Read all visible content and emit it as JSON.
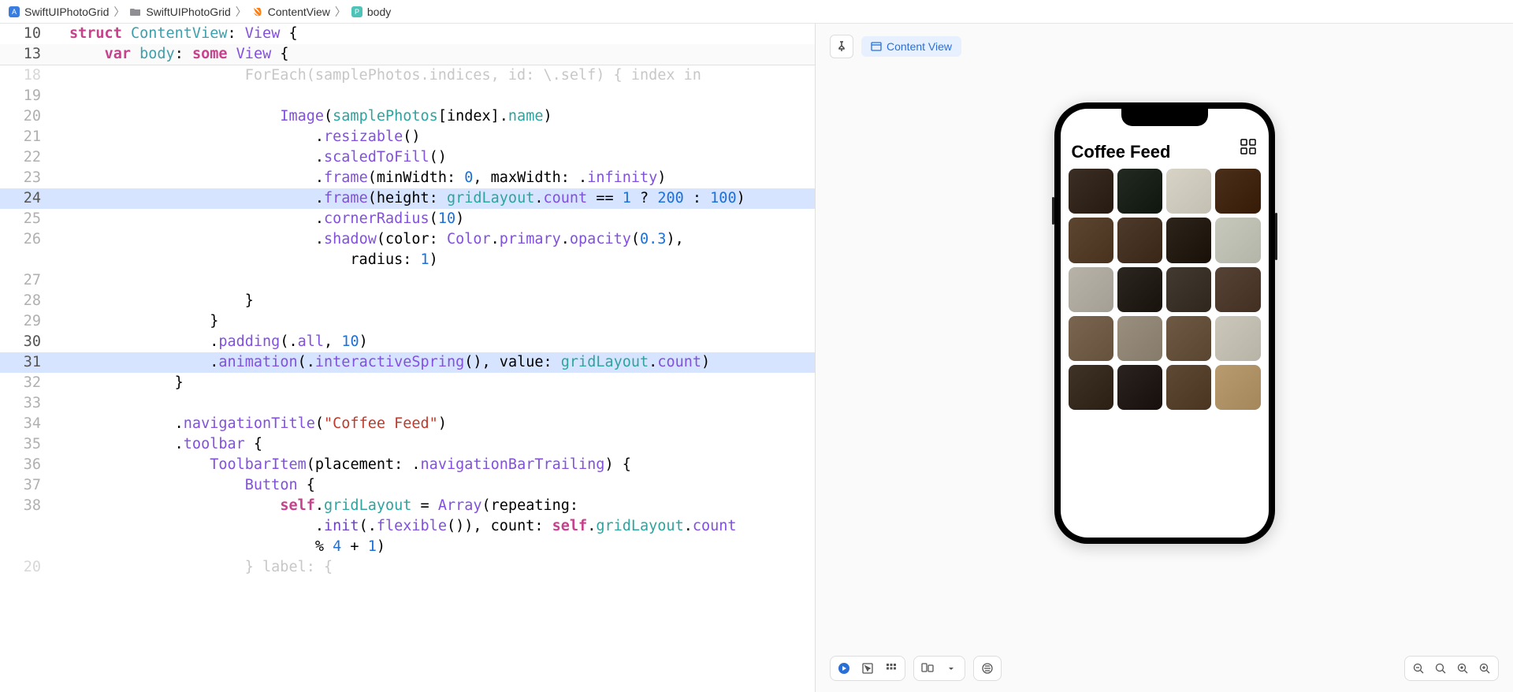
{
  "breadcrumb": {
    "items": [
      "SwiftUIPhotoGrid",
      "SwiftUIPhotoGrid",
      "ContentView",
      "body"
    ]
  },
  "preview": {
    "pill_label": "Content View",
    "app_title": "Coffee Feed"
  },
  "sticky": {
    "line10_num": "10",
    "line10_html": "<span class='kw-pink'>struct</span> <span class='cyan'>ContentView</span>: <span class='kw-purple'>View</span> {",
    "line13_num": "13",
    "line13_html": "    <span class='kw-pink'>var</span> <span class='cyan'>body</span>: <span class='kw-pink'>some</span> <span class='kw-purple'>View</span> {"
  },
  "lines": [
    {
      "num": "18",
      "dim": true,
      "hl": false,
      "html": "                    ForEach(samplePhotos.indices, id: \\.self) { index in"
    },
    {
      "num": "19",
      "dim": false,
      "hl": false,
      "html": ""
    },
    {
      "num": "20",
      "dim": false,
      "hl": false,
      "html": "                        <span class='kw-purple'>Image</span>(<span class='teal'>samplePhotos</span>[index].<span class='teal'>name</span>)"
    },
    {
      "num": "21",
      "dim": false,
      "hl": false,
      "html": "                            .<span class='kw-purple'>resizable</span>()"
    },
    {
      "num": "22",
      "dim": false,
      "hl": false,
      "html": "                            .<span class='kw-purple'>scaledToFill</span>()"
    },
    {
      "num": "23",
      "dim": false,
      "hl": false,
      "html": "                            .<span class='kw-purple'>frame</span>(minWidth: <span class='num'>0</span>, maxWidth: .<span class='kw-purple'>infinity</span>)"
    },
    {
      "num": "24",
      "dim": false,
      "hl": true,
      "html": "                            .<span class='kw-purple'>frame</span>(height: <span class='teal'>gridLayout</span>.<span class='kw-purple'>count</span> == <span class='num'>1</span> ? <span class='num'>200</span> : <span class='num'>100</span>)"
    },
    {
      "num": "25",
      "dim": false,
      "hl": false,
      "html": "                            .<span class='kw-purple'>cornerRadius</span>(<span class='num'>10</span>)"
    },
    {
      "num": "26",
      "dim": false,
      "hl": false,
      "html": "                            .<span class='kw-purple'>shadow</span>(color: <span class='kw-purple'>Color</span>.<span class='kw-purple'>primary</span>.<span class='kw-purple'>opacity</span>(<span class='num'>0.3</span>),\n                                radius: <span class='num'>1</span>)"
    },
    {
      "num": "27",
      "dim": false,
      "hl": false,
      "html": ""
    },
    {
      "num": "28",
      "dim": false,
      "hl": false,
      "html": "                    }"
    },
    {
      "num": "29",
      "dim": false,
      "hl": false,
      "html": "                }"
    },
    {
      "num": "30",
      "dim": false,
      "hl": false,
      "html": "                .<span class='kw-purple'>padding</span>(.<span class='kw-purple'>all</span>, <span class='num'>10</span>)"
    },
    {
      "num": "31",
      "dim": false,
      "hl": true,
      "html": "                .<span class='kw-purple'>animation</span>(.<span class='kw-purple'>interactiveSpring</span>(), value: <span class='teal'>gridLayout</span>.<span class='kw-purple'>count</span>)"
    },
    {
      "num": "32",
      "dim": false,
      "hl": false,
      "html": "            }"
    },
    {
      "num": "33",
      "dim": false,
      "hl": false,
      "html": ""
    },
    {
      "num": "34",
      "dim": false,
      "hl": false,
      "html": "            .<span class='kw-purple'>navigationTitle</span>(<span class='str'>\"Coffee Feed\"</span>)"
    },
    {
      "num": "35",
      "dim": false,
      "hl": false,
      "html": "            .<span class='kw-purple'>toolbar</span> {"
    },
    {
      "num": "36",
      "dim": false,
      "hl": false,
      "html": "                <span class='kw-purple'>ToolbarItem</span>(placement: .<span class='kw-purple'>navigationBarTrailing</span>) {"
    },
    {
      "num": "37",
      "dim": false,
      "hl": false,
      "html": "                    <span class='kw-purple'>Button</span> {"
    },
    {
      "num": "38",
      "dim": false,
      "hl": false,
      "html": "                        <span class='kw-pink'>self</span>.<span class='teal'>gridLayout</span> = <span class='kw-purple'>Array</span>(repeating:\n                            .<span class='member'>init</span>(.<span class='kw-purple'>flexible</span>()), count: <span class='kw-pink'>self</span>.<span class='teal'>gridLayout</span>.<span class='kw-purple'>count</span>\n                            % <span class='num'>4</span> + <span class='num'>1</span>)"
    },
    {
      "num": "20",
      "dim": true,
      "hl": false,
      "html": "                    } label: {"
    }
  ],
  "photo_colors": [
    "#3b2e24",
    "#232a22",
    "#d8d3c7",
    "#4a2f1b",
    "#5c4631",
    "#4d3a2a",
    "#2d241c",
    "#c7c9bd",
    "#b7b3a9",
    "#2c2620",
    "#433a31",
    "#564335",
    "#7a6650",
    "#9a8f7e",
    "#6e5a44",
    "#cbc7ba",
    "#3f3327",
    "#2a2320",
    "#5e4935",
    "#b89b6f"
  ]
}
